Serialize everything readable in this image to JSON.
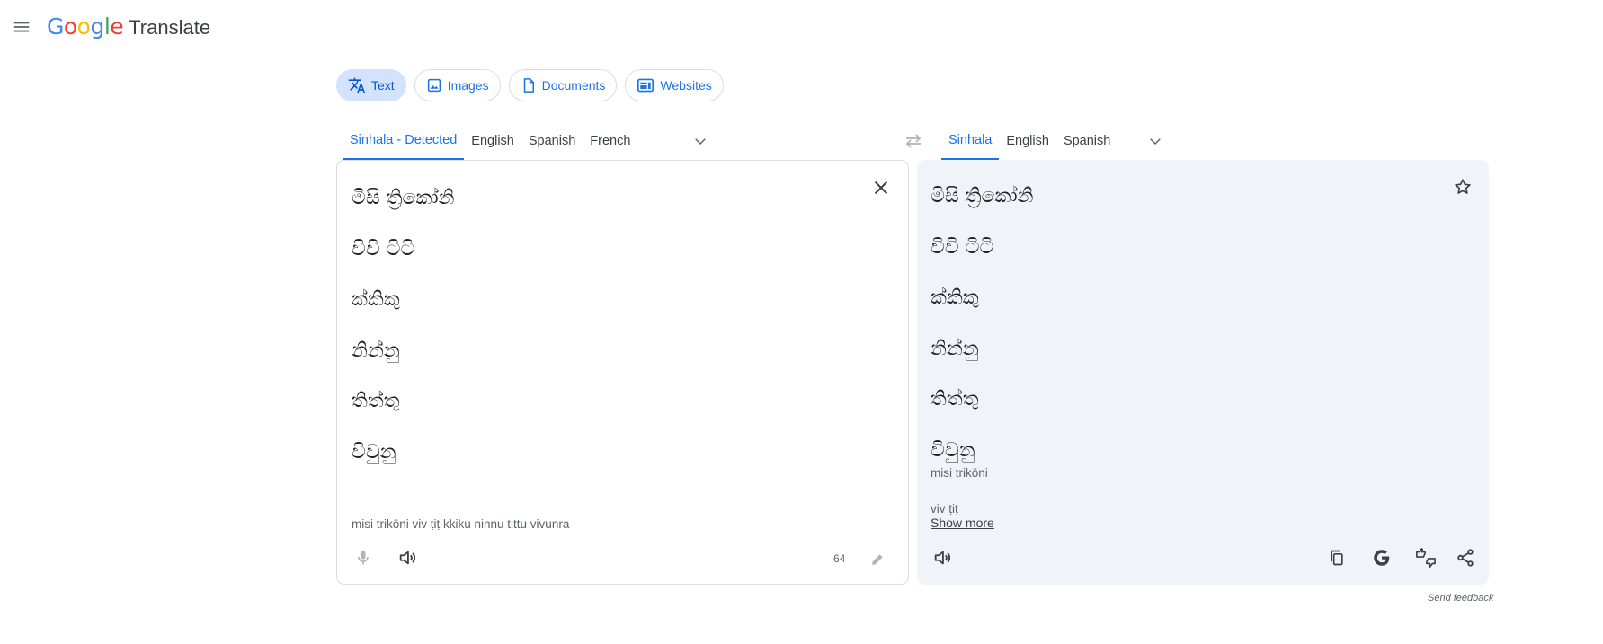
{
  "header": {
    "logo_letters": [
      "G",
      "o",
      "o",
      "g",
      "l",
      "e"
    ],
    "logo_colors": [
      "#4285f4",
      "#ea4335",
      "#fbbc05",
      "#4285f4",
      "#34a853",
      "#ea4335"
    ],
    "product": "Translate"
  },
  "modes": [
    {
      "label": "Text",
      "icon": "translate-icon",
      "active": true
    },
    {
      "label": "Images",
      "icon": "image-icon",
      "active": false
    },
    {
      "label": "Documents",
      "icon": "document-icon",
      "active": false
    },
    {
      "label": "Websites",
      "icon": "website-icon",
      "active": false
    }
  ],
  "source": {
    "languages": [
      "Sinhala - Detected",
      "English",
      "Spanish",
      "French"
    ],
    "active_index": 0,
    "lines": [
      "මිසි ත්‍රිකෝනි",
      "විවි ටිටි",
      "ක්කිකු",
      "නින්නු",
      "තිත්තු",
      "විවුනු"
    ],
    "transliteration": "misi trikōni viv ṭiṭ kkiku ninnu tittu vivunra",
    "char_count": "64"
  },
  "target": {
    "languages": [
      "Sinhala",
      "English",
      "Spanish"
    ],
    "active_index": 0,
    "lines": [
      "මිසි ත්‍රිකෝනි",
      "විවි ටිටි",
      "ක්කිකු",
      "නින්නු",
      "තිත්තු",
      "විවුනු"
    ],
    "transliteration_1": "misi trikōni",
    "transliteration_2": "viv ṭiṭ",
    "show_more": "Show more"
  },
  "footer": {
    "send_feedback": "Send feedback"
  },
  "colors": {
    "accent": "#1a73e8",
    "active_chip": "#d3e3fd",
    "target_panel_bg": "#f0f4f9"
  }
}
